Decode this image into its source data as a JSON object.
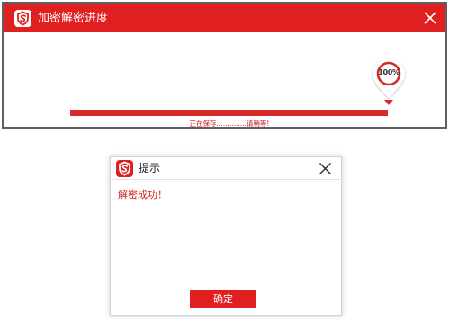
{
  "colors": {
    "accent": "#e02020",
    "status_text": "#c81a1a",
    "window_border": "#5f5f5f"
  },
  "progress_window": {
    "title": "加密解密进度",
    "logo_icon": "app-shield-logo-icon",
    "close_icon": "close-icon",
    "progress": {
      "fraction": 1.0,
      "label": "100%"
    },
    "status": "正在保存..............请稍等!"
  },
  "dialog": {
    "title": "提示",
    "logo_icon": "app-shield-logo-icon",
    "close_icon": "close-icon",
    "message": "解密成功！",
    "ok_label": "确定"
  }
}
